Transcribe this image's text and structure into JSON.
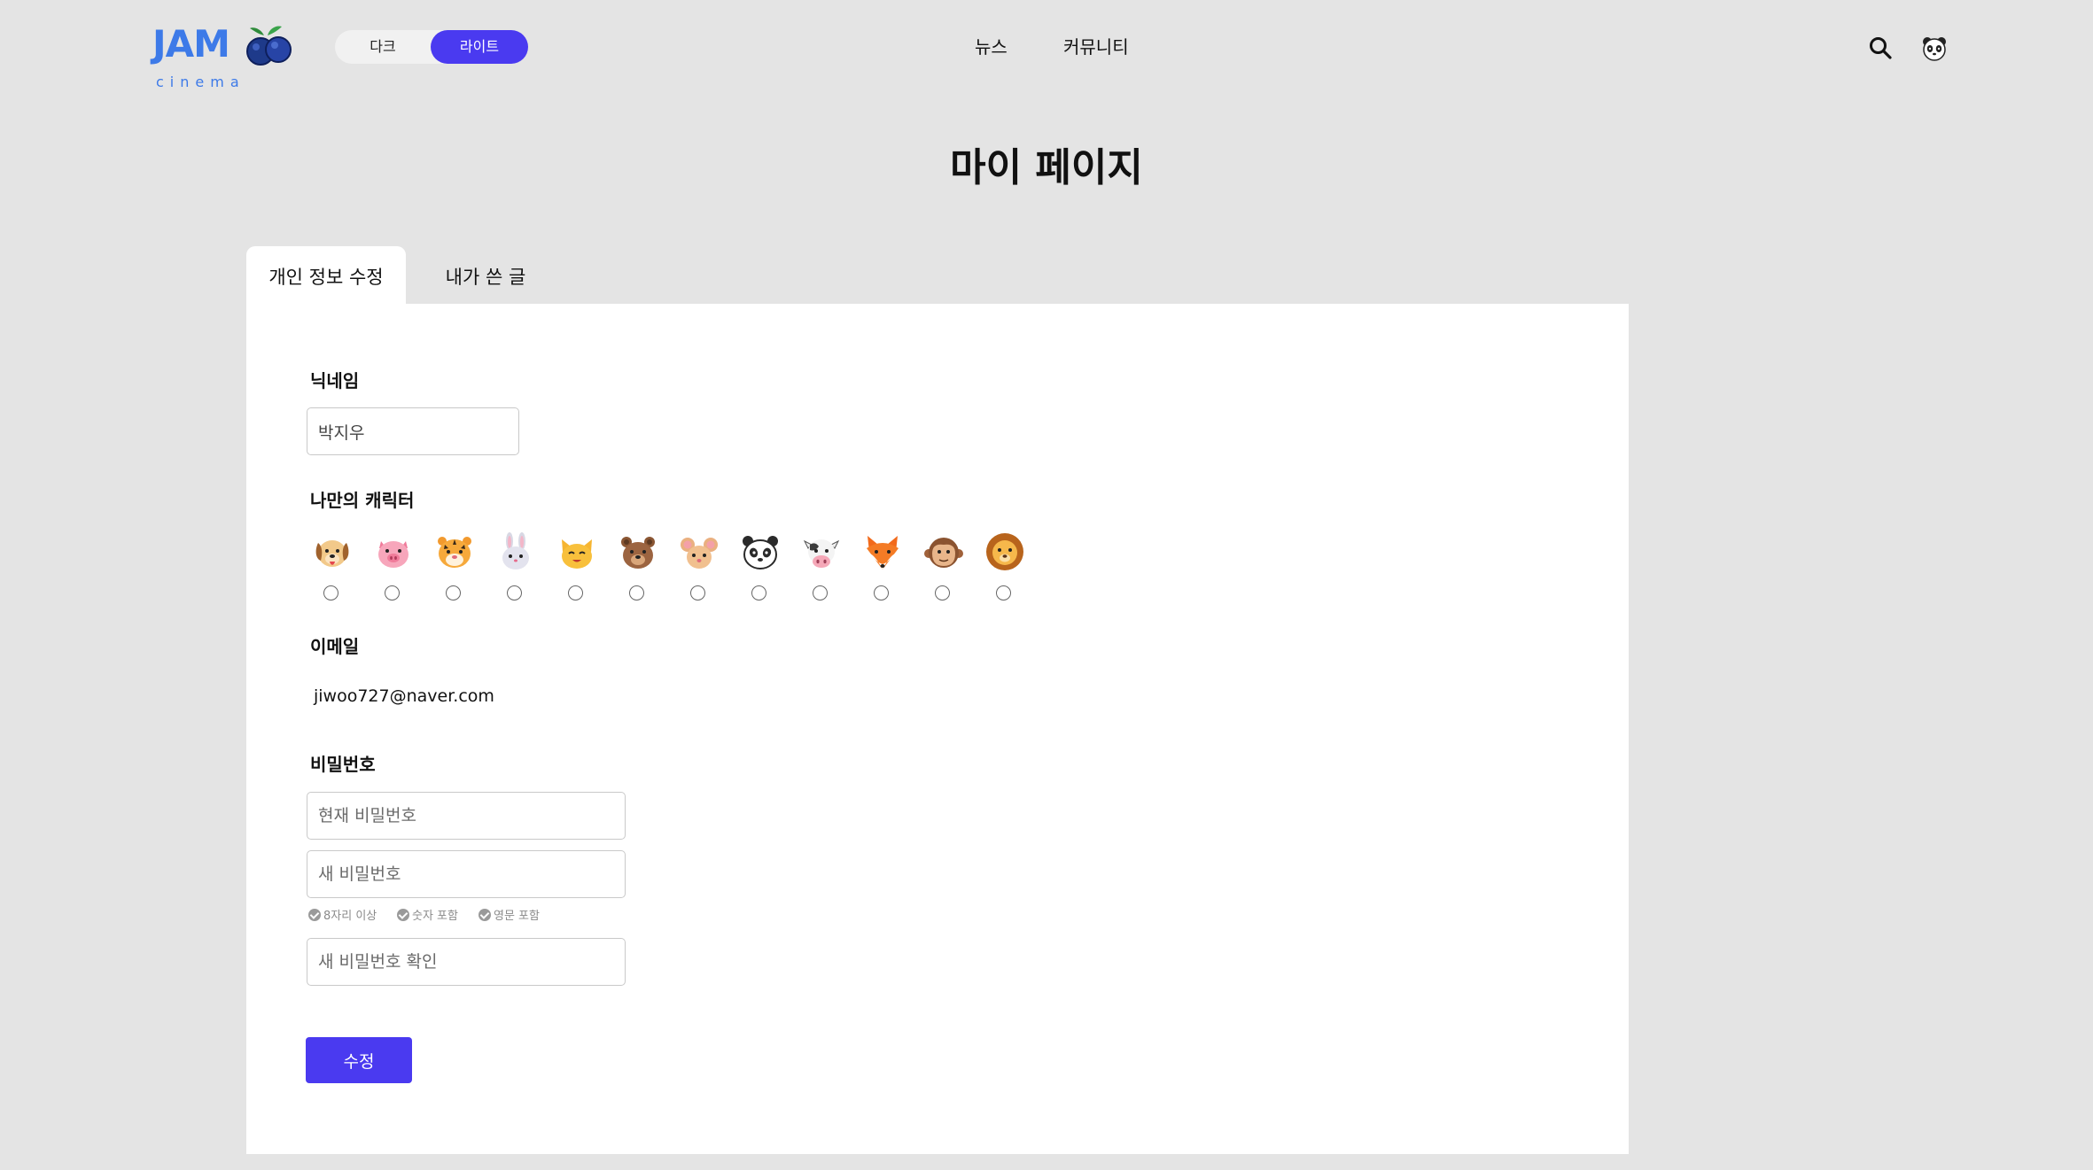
{
  "header": {
    "logo_text": "JAM",
    "logo_sub": "cinema",
    "theme_dark_label": "다크",
    "theme_light_label": "라이트",
    "nav": [
      "뉴스",
      "커뮤니티"
    ]
  },
  "page_title": "마이 페이지",
  "tabs": [
    {
      "label": "개인 정보 수정",
      "active": true
    },
    {
      "label": "내가 쓴 글",
      "active": false
    }
  ],
  "form": {
    "nickname_label": "닉네임",
    "nickname_value": "박지우",
    "character_label": "나만의 캐릭터",
    "characters": [
      "dog-icon",
      "pig-icon",
      "tiger-icon",
      "rabbit-icon",
      "cat-icon",
      "bear-icon",
      "mouse-icon",
      "panda-icon",
      "cow-icon",
      "fox-icon",
      "monkey-icon",
      "lion-icon"
    ],
    "email_label": "이메일",
    "email_value": "jiwoo727@naver.com",
    "password_label": "비밀번호",
    "current_password_placeholder": "현재 비밀번호",
    "new_password_placeholder": "새 비밀번호",
    "confirm_password_placeholder": "새 비밀번호 확인",
    "rules": [
      "8자리 이상",
      "숫자 포함",
      "영문 포함"
    ],
    "submit_label": "수정"
  },
  "colors": {
    "background": "#e4e4e4",
    "accent": "#4a3af0",
    "logo_blue": "#3d7ae8"
  }
}
